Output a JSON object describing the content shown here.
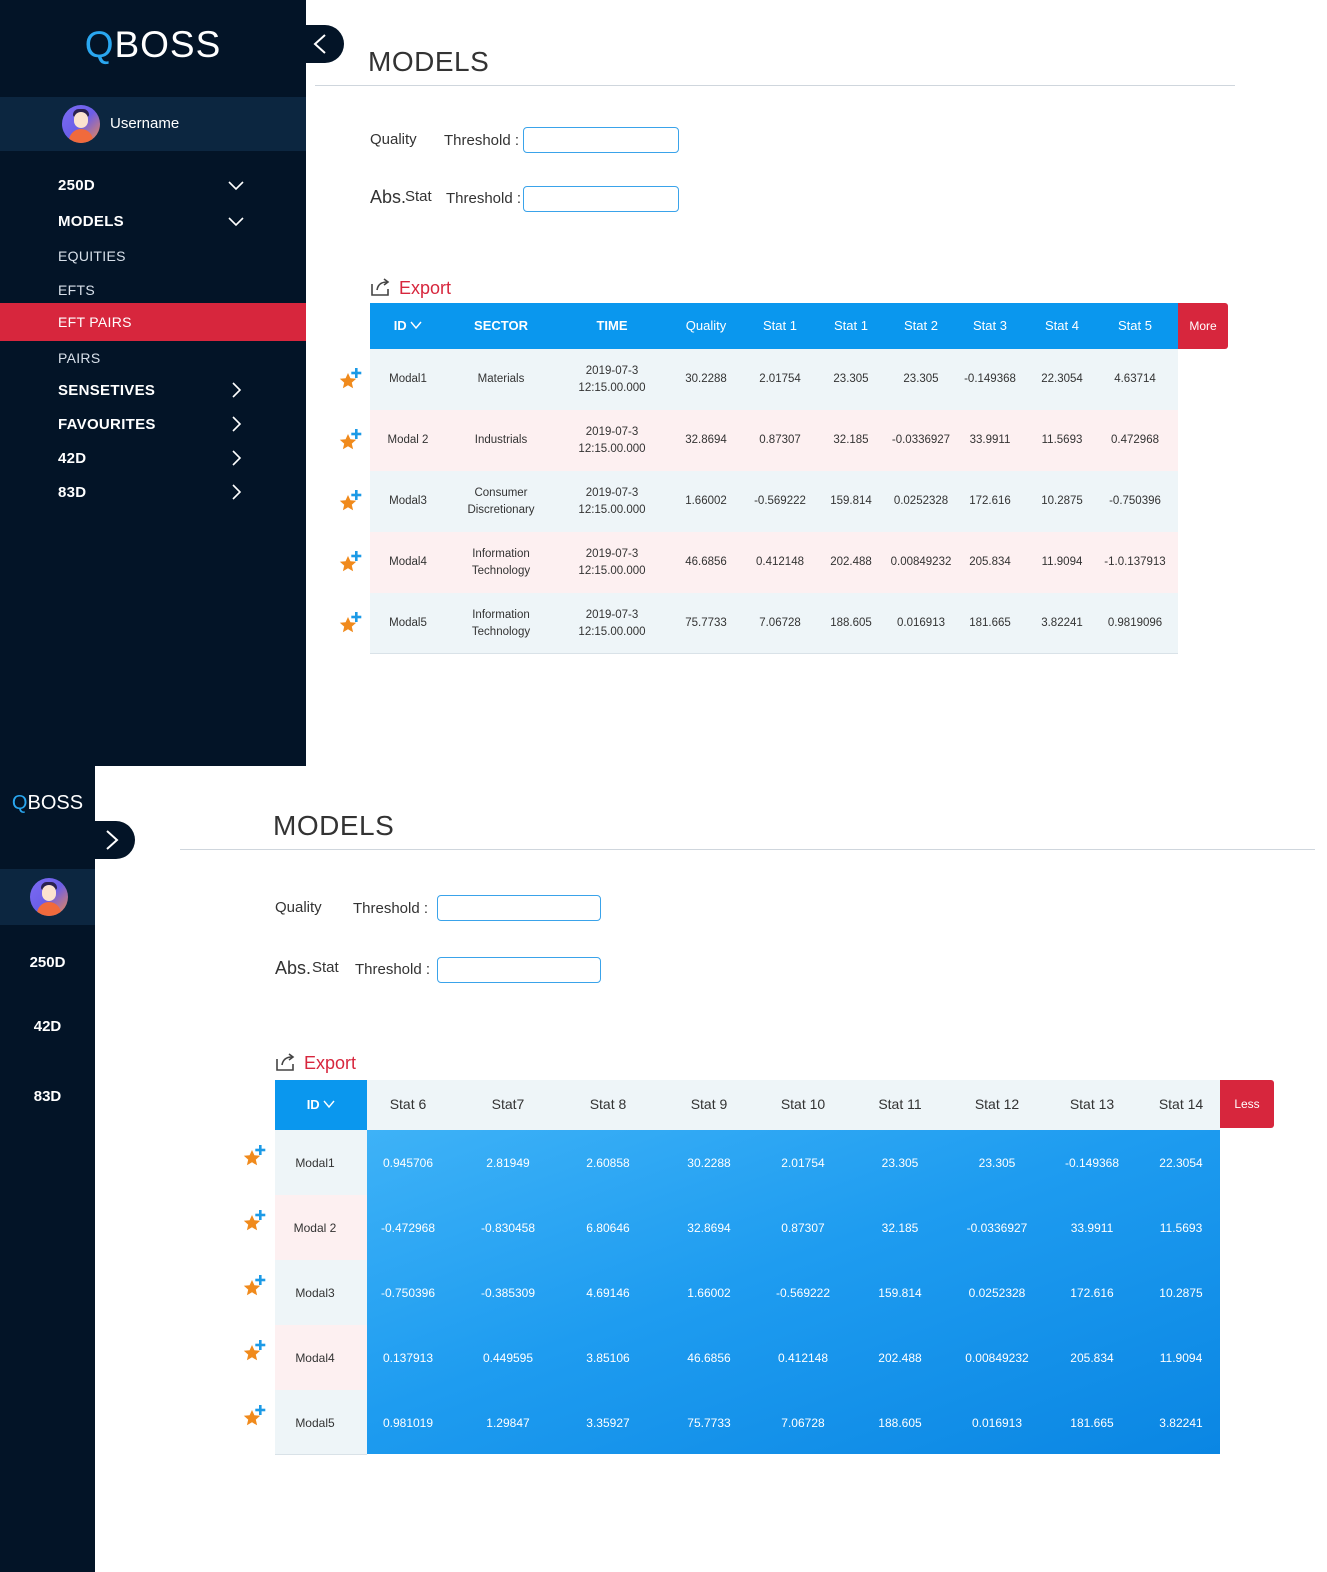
{
  "brand": {
    "q": "Q",
    "rest": "BOSS"
  },
  "user": {
    "name": "Username"
  },
  "nav": [
    {
      "label": "250D",
      "type": "main",
      "chevron": "down"
    },
    {
      "label": "MODELS",
      "type": "main",
      "chevron": "down"
    },
    {
      "label": "EQUITIES",
      "type": "sub"
    },
    {
      "label": "EFTS",
      "type": "sub"
    },
    {
      "label": "EFT PAIRS",
      "type": "sub",
      "active": true
    },
    {
      "label": "PAIRS",
      "type": "sub"
    },
    {
      "label": "SENSETIVES",
      "type": "main",
      "chevron": "right"
    },
    {
      "label": "FAVOURITES",
      "type": "main",
      "chevron": "right"
    },
    {
      "label": "42D",
      "type": "main",
      "chevron": "right"
    },
    {
      "label": "83D",
      "type": "main",
      "chevron": "right"
    }
  ],
  "collapsed_nav": [
    "250D",
    "42D",
    "83D"
  ],
  "page": {
    "title": "MODELS"
  },
  "filters": {
    "quality_label": "Quality",
    "abs_label": "Abs.",
    "stat_label": "Stat",
    "threshold_label": "Threshold :",
    "quality_value": "",
    "abs_value": ""
  },
  "export_label": "Export",
  "more_label": "More",
  "less_label": "Less",
  "table1": {
    "headers": [
      "ID",
      "SECTOR",
      "TIME",
      "Quality",
      "Stat 1",
      "Stat 1",
      "Stat 2",
      "Stat 3",
      "Stat 4",
      "Stat 5"
    ],
    "rows": [
      {
        "id": "Modal1",
        "sector": [
          "Materials"
        ],
        "time": [
          "2019-07-3",
          "12:15.00.000"
        ],
        "values": [
          "30.2288",
          "2.01754",
          "23.305",
          "23.305",
          "-0.149368",
          "22.3054",
          "4.63714"
        ]
      },
      {
        "id": "Modal 2",
        "sector": [
          "Industrials"
        ],
        "time": [
          "2019-07-3",
          "12:15.00.000"
        ],
        "values": [
          "32.8694",
          "0.87307",
          "32.185",
          "-0.0336927",
          "33.9911",
          "11.5693",
          "0.472968"
        ]
      },
      {
        "id": "Modal3",
        "sector": [
          "Consumer",
          "Discretionary"
        ],
        "time": [
          "2019-07-3",
          "12:15.00.000"
        ],
        "values": [
          "1.66002",
          "-0.569222",
          "159.814",
          "0.0252328",
          "172.616",
          "10.2875",
          "-0.750396"
        ]
      },
      {
        "id": "Modal4",
        "sector": [
          "Information",
          "Technology"
        ],
        "time": [
          "2019-07-3",
          "12:15.00.000"
        ],
        "values": [
          "46.6856",
          "0.412148",
          "202.488",
          "0.00849232",
          "205.834",
          "11.9094",
          "-1.0.137913"
        ]
      },
      {
        "id": "Modal5",
        "sector": [
          "Information",
          "Technology"
        ],
        "time": [
          "2019-07-3",
          "12:15.00.000"
        ],
        "values": [
          "75.7733",
          "7.06728",
          "188.605",
          "0.016913",
          "181.665",
          "3.82241",
          "0.9819096"
        ]
      }
    ]
  },
  "table2": {
    "headers": [
      "ID",
      "Stat 6",
      "Stat7",
      "Stat 8",
      "Stat 9",
      "Stat 10",
      "Stat 11",
      "Stat 12",
      "Stat 13",
      "Stat 14"
    ],
    "rows": [
      {
        "id": "Modal1",
        "values": [
          "0.945706",
          "2.81949",
          "2.60858",
          "30.2288",
          "2.01754",
          "23.305",
          "23.305",
          "-0.149368",
          "22.3054"
        ]
      },
      {
        "id": "Modal 2",
        "values": [
          "-0.472968",
          "-0.830458",
          "6.80646",
          "32.8694",
          "0.87307",
          "32.185",
          "-0.0336927",
          "33.9911",
          "11.5693"
        ]
      },
      {
        "id": "Modal3",
        "values": [
          "-0.750396",
          "-0.385309",
          "4.69146",
          "1.66002",
          "-0.569222",
          "159.814",
          "0.0252328",
          "172.616",
          "10.2875"
        ]
      },
      {
        "id": "Modal4",
        "values": [
          "0.137913",
          "0.449595",
          "3.85106",
          "46.6856",
          "0.412148",
          "202.488",
          "0.00849232",
          "205.834",
          "11.9094"
        ]
      },
      {
        "id": "Modal5",
        "values": [
          "0.981019",
          "1.29847",
          "3.35927",
          "75.7733",
          "7.06728",
          "188.605",
          "0.016913",
          "181.665",
          "3.82241"
        ]
      }
    ]
  },
  "colors": {
    "sidebar": "#031427",
    "accent_blue": "#0a97ee",
    "accent_red": "#d7263d",
    "logo_q": "#2aa7f0",
    "star": "#f08a1c"
  }
}
